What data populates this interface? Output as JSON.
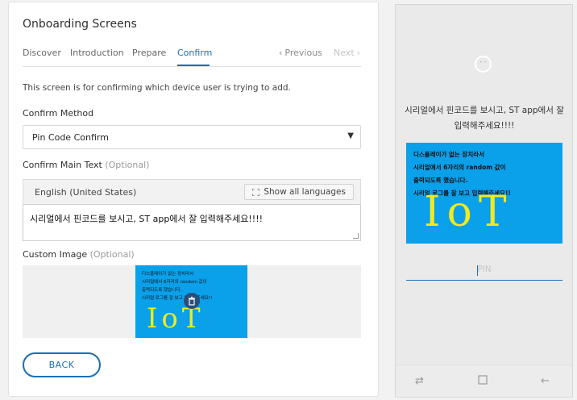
{
  "card": {
    "title": "Onboarding Screens",
    "tabs": [
      {
        "label": "Discover"
      },
      {
        "label": "Introduction"
      },
      {
        "label": "Prepare"
      },
      {
        "label": "Confirm"
      }
    ],
    "active_tab": "Confirm",
    "previous_label": "Previous",
    "next_label": "Next",
    "description": "This screen is for confirming which device user is trying to add.",
    "confirm_method_label": "Confirm Method",
    "confirm_method_value": "Pin Code Confirm",
    "confirm_main_text_label": "Confirm Main Text",
    "optional_label": "(Optional)",
    "language": "English (United States)",
    "show_all_languages": "Show all languages",
    "main_text_value": "시리얼에서 핀코드를 보시고, ST app에서 잘 입력해주세요!!!!",
    "custom_image_label": "Custom Image",
    "custom_image_optional": "(Optional)",
    "back_label": "BACK"
  },
  "image": {
    "lines": [
      "디스플레이가 없는 장치라서",
      "시리얼에서 6자리의 random 값이",
      "출력되도록 했습니다.",
      "시리얼 로그를 잘 보고 입력해주세요!!"
    ],
    "logo_text": "IoT"
  },
  "preview": {
    "main_text": "시리얼에서 핀코드를 보시고, ST app에서 잘 입력해주세요!!!!",
    "pin_placeholder": "PIN",
    "nav_icons": [
      "recent-apps-icon",
      "home-icon",
      "back-icon"
    ]
  },
  "colors": {
    "accent": "#1a6fb8",
    "image_bg": "#0aa0ea",
    "logo": "#f0ea20"
  }
}
